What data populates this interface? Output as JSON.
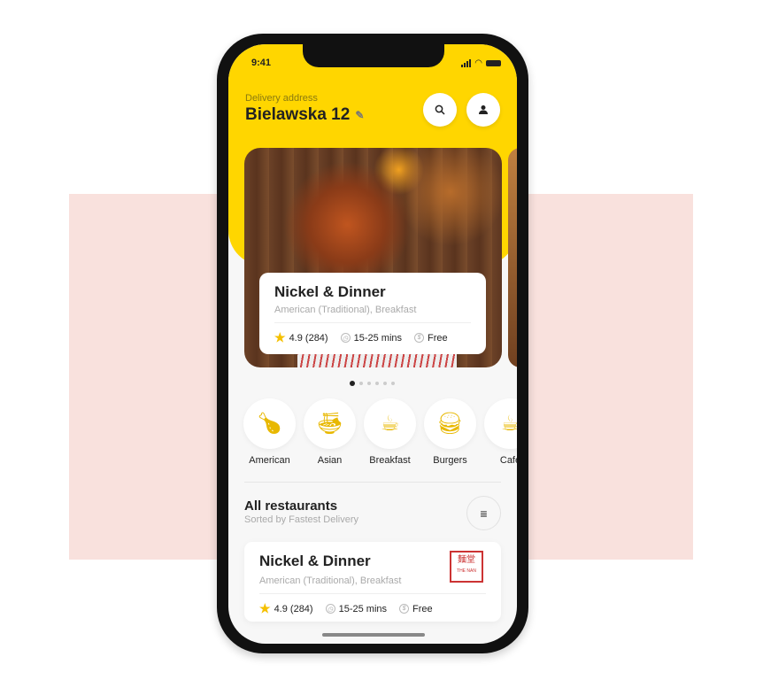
{
  "status": {
    "time": "9:41"
  },
  "header": {
    "address_label": "Delivery address",
    "address": "Bielawska 12"
  },
  "featured": {
    "name": "Nickel & Dinner",
    "cuisine": "American (Traditional), Breakfast",
    "rating": "4.9 (284)",
    "time": "15-25 mins",
    "delivery": "Free",
    "pages": 6,
    "active_page": 1
  },
  "categories": [
    {
      "label": "American",
      "icon": "chicken-leg-icon"
    },
    {
      "label": "Asian",
      "icon": "noodle-bowl-icon"
    },
    {
      "label": "Breakfast",
      "icon": "breakfast-icon"
    },
    {
      "label": "Burgers",
      "icon": "burger-icon"
    },
    {
      "label": "Cafe",
      "icon": "teapot-icon"
    }
  ],
  "list": {
    "title": "All restaurants",
    "subtitle": "Sorted by Fastest Delivery",
    "items": [
      {
        "name": "Nickel & Dinner",
        "cuisine": "American (Traditional), Breakfast",
        "rating": "4.9 (284)",
        "time": "15-25 mins",
        "delivery": "Free",
        "logo_text": "麵堂",
        "logo_sub": "THE NAN"
      }
    ]
  },
  "colors": {
    "accent": "#ffd600",
    "background": "#f9e1dd"
  }
}
